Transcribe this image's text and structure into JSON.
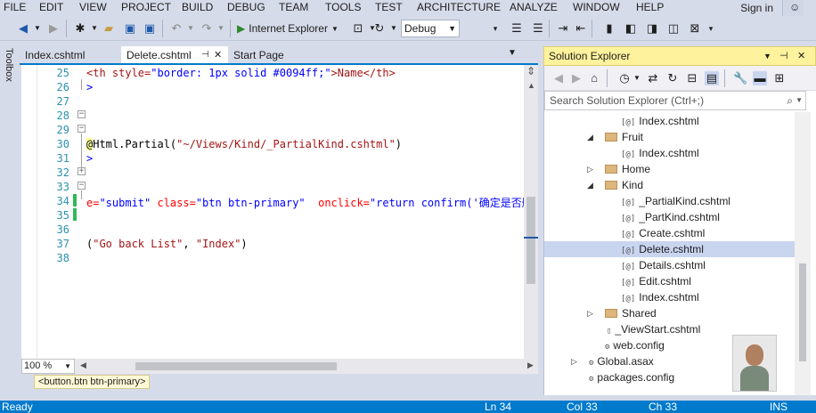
{
  "menu": {
    "items": [
      "FILE",
      "EDIT",
      "VIEW",
      "PROJECT",
      "BUILD",
      "DEBUG",
      "TEAM",
      "TOOLS",
      "TEST",
      "ARCHITECTURE",
      "ANALYZE",
      "WINDOW",
      "HELP"
    ],
    "sign_in": "Sign in"
  },
  "toolbar": {
    "run_target": "Internet Explorer",
    "configuration": "Debug"
  },
  "toolbox": {
    "label": "Toolbox"
  },
  "tabs": [
    {
      "label": "Index.cshtml",
      "active": false
    },
    {
      "label": "Delete.cshtml",
      "active": true,
      "pin": "⊿"
    },
    {
      "label": "Start Page",
      "active": false
    }
  ],
  "editor": {
    "line_numbers": [
      "25",
      "26",
      "27",
      "28",
      "29",
      "30",
      "31",
      "32",
      "33",
      "34",
      "35",
      "36",
      "37",
      "38"
    ],
    "lines": {
      "l25_a": "<th style=",
      "l25_b": "\"border: 1px solid #0094ff;\"",
      "l25_c": ">Name</th>",
      "l26": ">",
      "l30_a": "@",
      "l30_b": "Html.Partial(",
      "l30_c": "\"~/Views/Kind/_PartialKind.cshtml\"",
      "l30_d": ")",
      "l31": ">",
      "l34_a": "e=",
      "l34_b": "\"submit\"",
      "l34_c": " class=",
      "l34_d": "\"btn btn-primary\"",
      "l34_e": "  onclick=",
      "l34_f": "\"return confirm('确定是否删",
      "l37_a": "(",
      "l37_b": "\"Go back List\"",
      "l37_c": ", ",
      "l37_d": "\"Index\"",
      "l37_e": ")"
    },
    "zoom": "100 %",
    "breadcrumb": "<button.btn btn-primary>"
  },
  "solution_explorer": {
    "title": "Solution Explorer",
    "search_placeholder": "Search Solution Explorer (Ctrl+;)",
    "tree": [
      {
        "label": "Index.cshtml",
        "type": "file"
      },
      {
        "label": "Fruit",
        "type": "folder",
        "expanded": true
      },
      {
        "label": "Index.cshtml",
        "type": "file"
      },
      {
        "label": "Home",
        "type": "folder",
        "expanded": false
      },
      {
        "label": "Kind",
        "type": "folder",
        "expanded": true
      },
      {
        "label": "_PartialKind.cshtml",
        "type": "file"
      },
      {
        "label": "_PartKind.cshtml",
        "type": "file"
      },
      {
        "label": "Create.cshtml",
        "type": "file"
      },
      {
        "label": "Delete.cshtml",
        "type": "file",
        "selected": true
      },
      {
        "label": "Details.cshtml",
        "type": "file"
      },
      {
        "label": "Edit.cshtml",
        "type": "file"
      },
      {
        "label": "Index.cshtml",
        "type": "file"
      },
      {
        "label": "Shared",
        "type": "folder",
        "expanded": false
      },
      {
        "label": "_ViewStart.cshtml",
        "type": "file"
      },
      {
        "label": "web.config",
        "type": "file"
      },
      {
        "label": "Global.asax",
        "type": "file",
        "expanded": false
      },
      {
        "label": "packages.config",
        "type": "file"
      }
    ]
  },
  "status": {
    "ready": "Ready",
    "line": "Ln 34",
    "col": "Col 33",
    "ch": "Ch 33",
    "mode": "INS"
  },
  "colors": {
    "accent": "#007acc",
    "selected": "#c9d4ef",
    "explorer_title": "#fff29d"
  }
}
